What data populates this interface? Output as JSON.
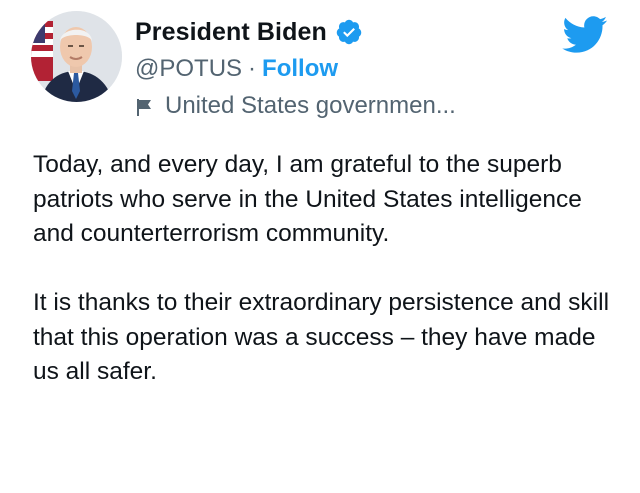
{
  "tweet": {
    "author": {
      "display_name": "President Biden",
      "handle": "@POTUS",
      "separator": "·",
      "follow_label": "Follow",
      "account_label": "United States governmen...",
      "verified": true
    },
    "paragraphs": [
      "Today, and every day, I am grateful to the superb patriots who serve in the United States intelligence and counterterrorism community.",
      "It is thanks to their extraordinary persistence and skill that this operation was a success – they have made us all safer."
    ]
  },
  "icons": {
    "verified": "verified-badge-icon",
    "account_label": "flag-icon",
    "brand": "twitter-bird-icon",
    "avatar": "avatar"
  },
  "colors": {
    "accent": "#1d9bf0",
    "text_primary": "#0f1419",
    "text_secondary": "#536471",
    "background": "#ffffff"
  }
}
